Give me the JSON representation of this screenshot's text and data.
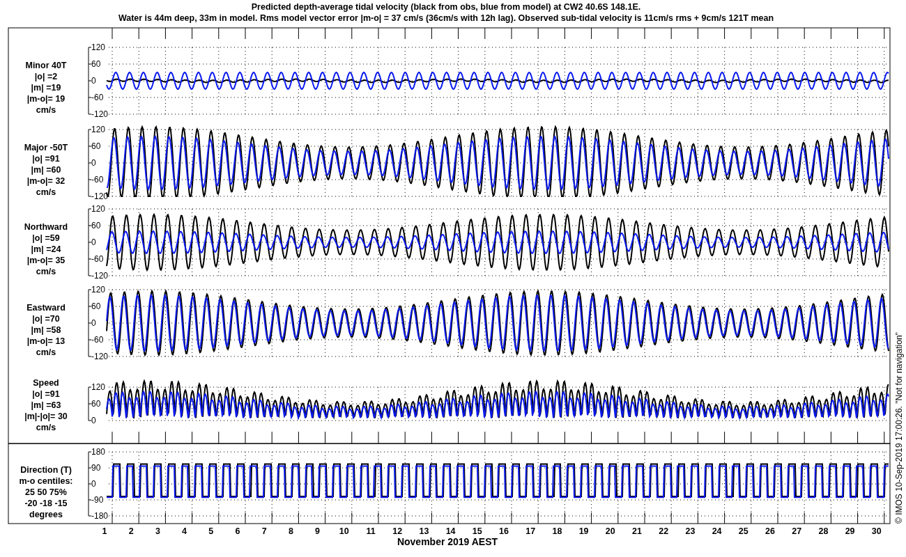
{
  "title_lines": [
    "Predicted depth-average tidal velocity (black from obs, blue from model) at CW2 40.6S 148.1E.",
    "Water is 44m deep, 33m in model. Rms model vector error |m-o| = 37 cm/s (36cm/s with 12h lag). Observed sub-tidal velocity is 11cm/s rms + 9cm/s 121T mean"
  ],
  "panels": [
    {
      "kind": "velocity",
      "label_lines": [
        "Minor 40T",
        "|o| =2",
        "|m| =19",
        "|m-o|= 19",
        "cm/s"
      ],
      "yticks": [
        "120",
        "60",
        "0",
        "-60",
        "-120"
      ]
    },
    {
      "kind": "velocity",
      "label_lines": [
        "Major -50T",
        "|o| =91",
        "|m| =60",
        "|m-o|= 32",
        "cm/s"
      ],
      "yticks": [
        "120",
        "60",
        "0",
        "-60",
        "-120"
      ]
    },
    {
      "kind": "velocity",
      "label_lines": [
        "Northward",
        "|o| =59",
        "|m| =24",
        "|m-o|= 35",
        "cm/s"
      ],
      "yticks": [
        "120",
        "60",
        "0",
        "-60",
        "-120"
      ]
    },
    {
      "kind": "velocity",
      "label_lines": [
        "Eastward",
        "|o| =70",
        "|m| =58",
        "|m-o|= 13",
        "cm/s"
      ],
      "yticks": [
        "120",
        "60",
        "0",
        "-60",
        "-120"
      ]
    },
    {
      "kind": "speed",
      "label_lines": [
        "Speed",
        "|o| =91",
        "|m| =63",
        "|m|-|o|= 30",
        "cm/s"
      ],
      "yticks": [
        "120",
        "60",
        "0"
      ]
    },
    {
      "kind": "direction",
      "label_lines": [
        "Direction (T)",
        "m-o centiles:",
        "25  50  75%",
        "-20 -18 -15",
        "degrees"
      ],
      "yticks": [
        "180",
        "90",
        "0",
        "-90",
        "-180"
      ]
    }
  ],
  "day_labels": [
    "1",
    "2",
    "3",
    "4",
    "5",
    "6",
    "7",
    "8",
    "9",
    "10",
    "11",
    "12",
    "13",
    "14",
    "15",
    "16",
    "17",
    "18",
    "19",
    "20",
    "21",
    "22",
    "23",
    "24",
    "25",
    "26",
    "27",
    "28",
    "29",
    "30"
  ],
  "xlabel": "November 2019 AEST",
  "credit": "© IMOS 10-Sep-2019 17:00:26. \"Not for navigation\""
}
